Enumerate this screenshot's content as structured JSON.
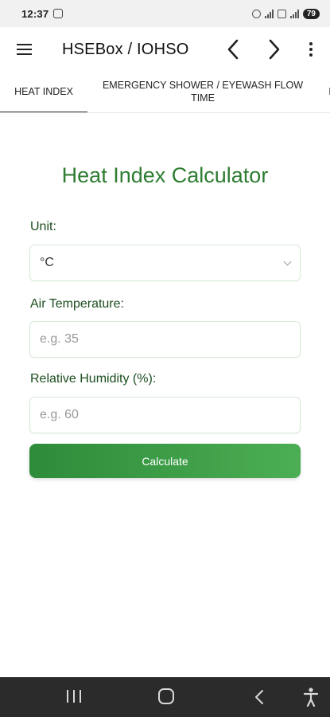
{
  "status_bar": {
    "time": "12:37",
    "battery": "79"
  },
  "app_bar": {
    "title": "HSEBox / IOHSO"
  },
  "tabs": [
    {
      "label": "HEAT INDEX",
      "active": true
    },
    {
      "label": "EMERGENCY SHOWER / EYEWASH FLOW TIME",
      "active": false
    },
    {
      "label": "I",
      "active": false
    }
  ],
  "calculator": {
    "title": "Heat Index Calculator",
    "unit_label": "Unit:",
    "unit_value": "°C",
    "temp_label": "Air Temperature:",
    "temp_placeholder": "e.g. 35",
    "humidity_label": "Relative Humidity (%):",
    "humidity_placeholder": "e.g. 60",
    "button_label": "Calculate"
  },
  "colors": {
    "accent_green": "#2e7d32",
    "button_start": "#2e8b3a",
    "button_end": "#4cae54"
  }
}
